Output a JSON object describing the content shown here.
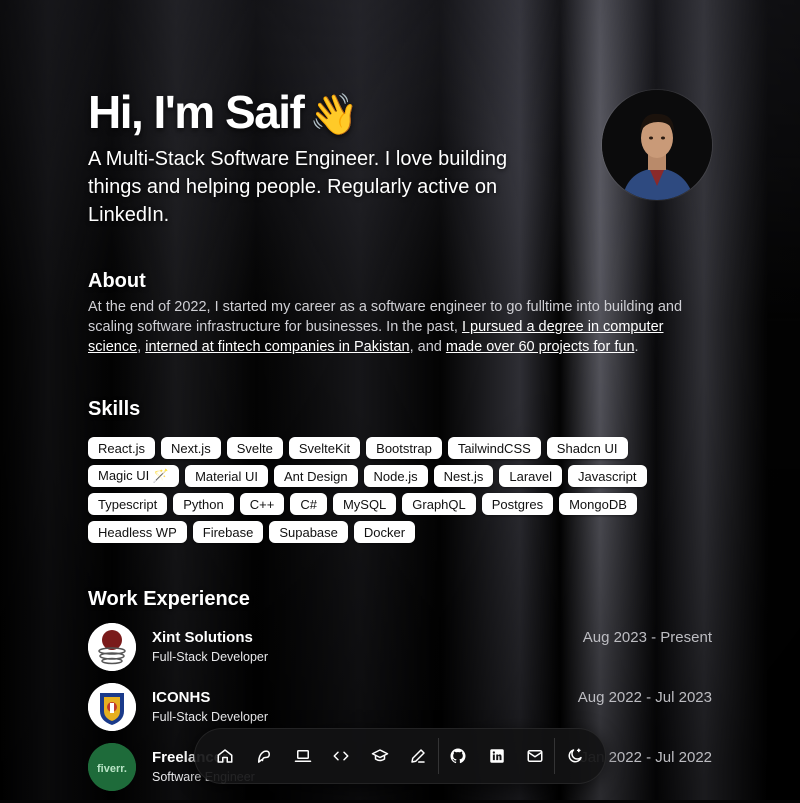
{
  "hero": {
    "greeting": "Hi, I'm Saif",
    "wave_emoji": "👋",
    "tagline": "A Multi-Stack Software Engineer. I love building things and helping people. Regularly active on LinkedIn."
  },
  "about": {
    "title": "About",
    "text_before": "At the end of 2022, I started my career as a software engineer to go fulltime into building and scaling software infrastructure for businesses. In the past, ",
    "link1": "I pursued a degree in computer science",
    "sep1": ", ",
    "link2": "interned at fintech companies in Pakistan",
    "sep2": ", and ",
    "link3": "made over 60 projects for fun",
    "text_after": "."
  },
  "skills": {
    "title": "Skills",
    "items": [
      "React.js",
      "Next.js",
      "Svelte",
      "SvelteKit",
      "Bootstrap",
      "TailwindCSS",
      "Shadcn UI",
      "Magic UI 🪄",
      "Material UI",
      "Ant Design",
      "Node.js",
      "Nest.js",
      "Laravel",
      "Javascript",
      "Typescript",
      "Python",
      "C++",
      "C#",
      "MySQL",
      "GraphQL",
      "Postgres",
      "MongoDB",
      "Headless WP",
      "Firebase",
      "Supabase",
      "Docker"
    ]
  },
  "work": {
    "title": "Work Experience",
    "jobs": [
      {
        "company": "Xint Solutions",
        "role": "Full-Stack Developer",
        "dates": "Aug 2023 - Present"
      },
      {
        "company": "ICONHS",
        "role": "Full-Stack Developer",
        "dates": "Aug 2022 - Jul 2023"
      },
      {
        "company": "Freelancer",
        "role": "Software Engineer",
        "dates": "Jan 2022 - Jul 2022",
        "logo_text": "fiverr."
      }
    ]
  },
  "dock": {
    "items": [
      "home-icon",
      "blog-icon",
      "laptop-icon",
      "code-icon",
      "graduation-cap-icon",
      "pencil-icon",
      "github-icon",
      "linkedin-icon",
      "mail-icon",
      "theme-toggle-icon"
    ]
  },
  "colors": {
    "background": "#050505",
    "badge_bg": "#ffffff",
    "badge_text": "#111111",
    "muted_text": "#cfcfd4"
  }
}
